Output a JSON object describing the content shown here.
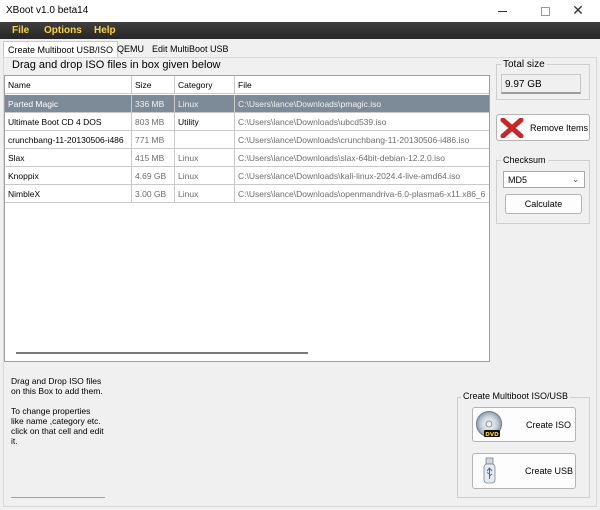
{
  "window": {
    "title": "XBoot v1.0 beta14"
  },
  "menu": [
    "File",
    "Options",
    "Help"
  ],
  "tabs": [
    "Create Multiboot USB/ISO",
    "QEMU",
    "Edit MultiBoot USB"
  ],
  "drop_title": "Drag and drop ISO files in box given below",
  "table": {
    "columns": [
      "Name",
      "Size",
      "Category",
      "File"
    ],
    "rows": [
      [
        "Parted Magic",
        "336 MB",
        "Linux",
        "C:\\Users\\lance\\Downloads\\pmagic.iso"
      ],
      [
        "Ultimate Boot CD 4 DOS",
        "803 MB",
        "Utility",
        "C:\\Users\\lance\\Downloads\\ubcd539.iso"
      ],
      [
        "crunchbang-11-20130506-i486",
        "771 MB",
        "",
        "C:\\Users\\lance\\Downloads\\crunchbang-11-20130506-i486.iso"
      ],
      [
        "Slax",
        "415 MB",
        "Linux",
        "C:\\Users\\lance\\Downloads\\slax-64bit-debian-12.2.0.iso"
      ],
      [
        "Knoppix",
        "4.69 GB",
        "Linux",
        "C:\\Users\\lance\\Downloads\\kali-linux-2024.4-live-amd64.iso"
      ],
      [
        "NimbleX",
        "3.00 GB",
        "Linux",
        "C:\\Users\\lance\\Downloads\\openmandriva-6.0-plasma6-x11.x86_6"
      ]
    ],
    "selected_row": 0
  },
  "info": {
    "line1": "Drag and Drop ISO files on this Box to add them.",
    "line2": "To change properties like name ,category etc. click on that cell and edit it."
  },
  "total": {
    "label": "Total size",
    "value": "9.97 GB"
  },
  "remove_label": "Remove Items",
  "checksum": {
    "label": "Checksum",
    "selected": "MD5",
    "button": "Calculate"
  },
  "create": {
    "label": "Create Multiboot ISO/USB",
    "iso": "Create ISO",
    "usb": "Create USB"
  },
  "colors": {
    "menubar": "#2f2f2f",
    "menu_text": "#ffd23a",
    "selected_row": "#7d8a97",
    "remove_x": "#c62828"
  }
}
